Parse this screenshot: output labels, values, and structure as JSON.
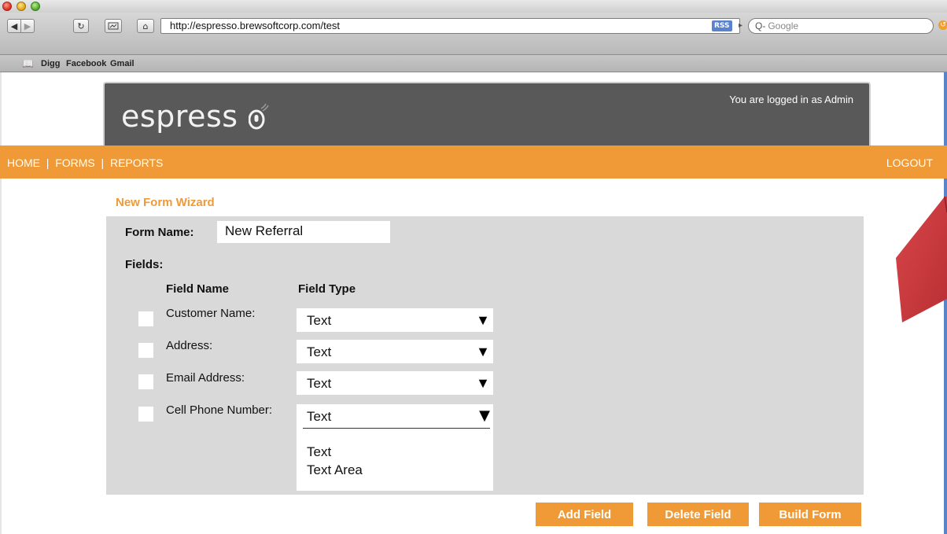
{
  "browser": {
    "url": "http://espresso.brewsoftcorp.com/test",
    "rss_label": "RSS",
    "search_placeholder": "Google",
    "search_prefix": "Q-",
    "bookmarks": [
      "Digg",
      "Facebook",
      "Gmail"
    ]
  },
  "header": {
    "logo_text": "espress",
    "login_message": "You are logged in as Admin"
  },
  "nav": {
    "home": "HOME",
    "forms": "FORMS",
    "reports": "REPORTS",
    "separator": "|",
    "logout": "LOGOUT"
  },
  "wizard": {
    "title": "New Form Wizard",
    "form_name_label": "Form Name:",
    "form_name_value": "New Referral",
    "fields_label": "Fields:",
    "col_field_name": "Field Name",
    "col_field_type": "Field Type",
    "rows": [
      {
        "name": "Customer Name:",
        "type": "Text"
      },
      {
        "name": "Address:",
        "type": "Text"
      },
      {
        "name": "Email Address:",
        "type": "Text"
      },
      {
        "name": "Cell Phone Number:",
        "type": "Text"
      }
    ],
    "dropdown_options": [
      "Text",
      "Text Area"
    ]
  },
  "actions": {
    "add": "Add Field",
    "delete": "Delete Field",
    "build": "Build Form"
  },
  "colors": {
    "accent": "#ef9a36",
    "header_bg": "#595959",
    "panel_bg": "#d9d9d9",
    "callout": "#c8373b"
  }
}
